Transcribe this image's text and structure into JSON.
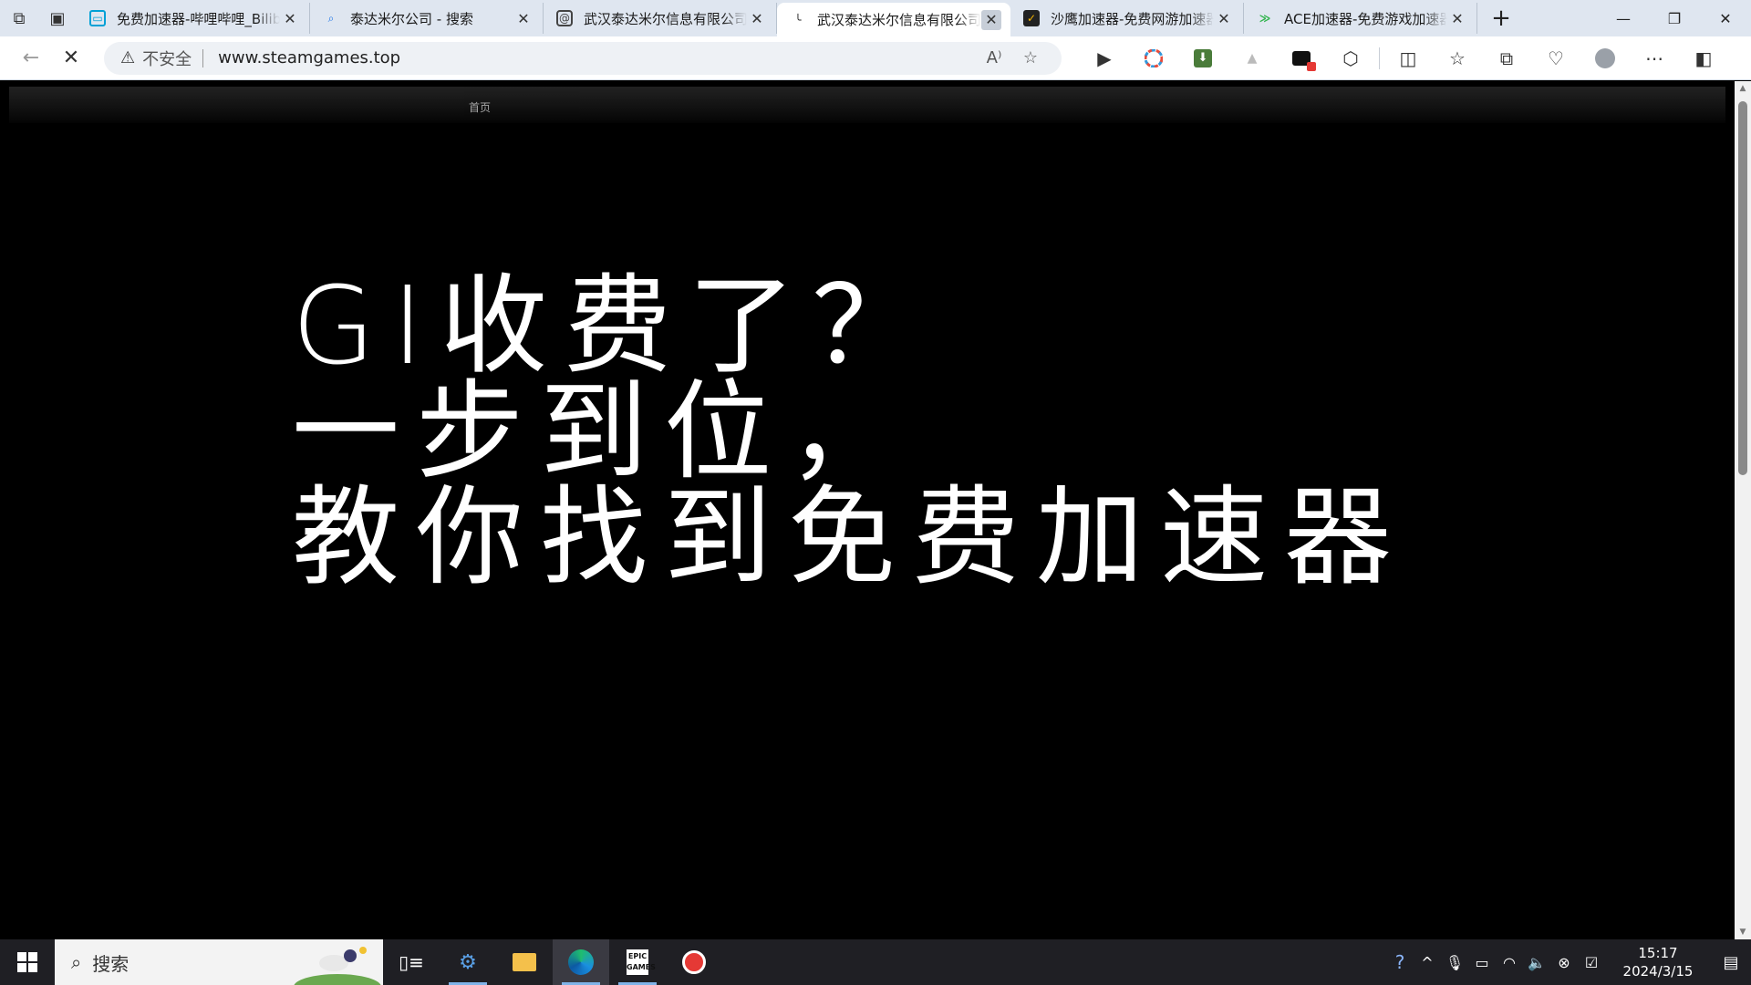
{
  "browser": {
    "tabs": [
      {
        "title": "免费加速器-哔哩哔哩_Bilibili",
        "favicon": "bilibili-icon",
        "color": "#00a1d6"
      },
      {
        "title": "泰达米尔公司 - 搜索",
        "favicon": "bing-search-icon",
        "color": "#1a73e8"
      },
      {
        "title": "武汉泰达米尔信息有限公司",
        "favicon": "web-icon",
        "color": "#444444"
      },
      {
        "title": "武汉泰达米尔信息有限公司",
        "favicon": "loading-icon",
        "color": "#222222"
      },
      {
        "title": "沙鹰加速器-免费网游加速器",
        "favicon": "eagle-icon",
        "color": "#f5b400"
      },
      {
        "title": "ACE加速器-免费游戏加速器",
        "favicon": "ace-icon",
        "color": "#2db34a"
      }
    ],
    "active_tab_index": 3,
    "address": {
      "security_label": "不安全",
      "url": "www.steamgames.top"
    }
  },
  "page": {
    "nav_home": "首页",
    "overlay_lines": [
      "GI收费了？",
      "一步到位，",
      "教你找到免费加速器"
    ]
  },
  "taskbar": {
    "search_placeholder": "搜索",
    "time": "15:17",
    "date": "2024/3/15"
  }
}
